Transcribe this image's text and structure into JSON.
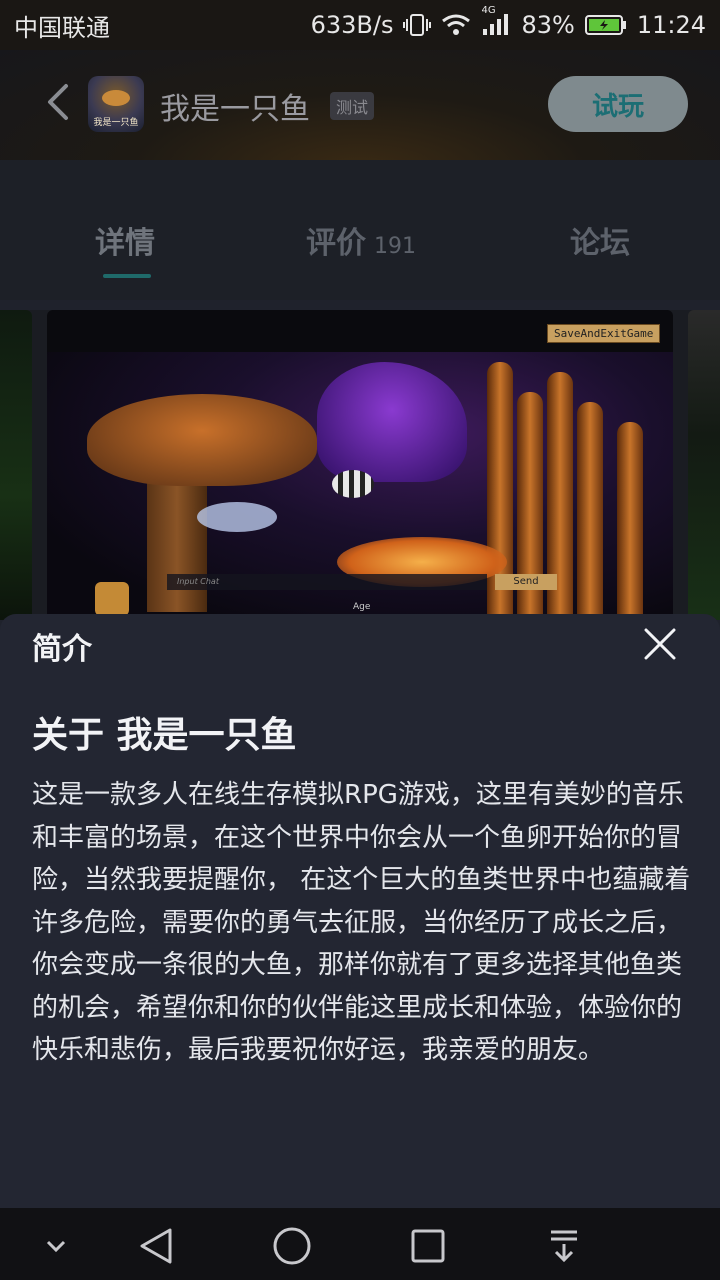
{
  "status_bar": {
    "carrier": "中国联通",
    "speed": "633B/s",
    "network": "4G",
    "battery": "83%",
    "time": "11:24"
  },
  "header": {
    "app_name": "我是一只鱼",
    "badge": "测试",
    "icon_text": "我是一只鱼",
    "try_button": "试玩"
  },
  "tabs": [
    {
      "label": "详情",
      "active": true
    },
    {
      "label": "评价",
      "count": "191"
    },
    {
      "label": "论坛"
    }
  ],
  "screenshot": {
    "save_button": "SaveAndExitGame",
    "chat_placeholder": "Input Chat",
    "send_button": "Send",
    "age_label": "Age"
  },
  "intro": {
    "title": "简介",
    "heading": "关于 我是一只鱼",
    "description": "这是一款多人在线生存模拟RPG游戏，这里有美妙的音乐和丰富的场景，在这个世界中你会从一个鱼卵开始你的冒险，当然我要提醒你， 在这个巨大的鱼类世界中也蕴藏着许多危险，需要你的勇气去征服，当你经历了成长之后，你会变成一条很的大鱼，那样你就有了更多选择其他鱼类的机会，希望你和你的伙伴能这里成长和体验，体验你的快乐和悲伤，最后我要祝你好运，我亲爱的朋友。"
  },
  "nav_bar": {
    "icons": [
      "chevron-down-icon",
      "back-triangle-icon",
      "home-circle-icon",
      "recents-square-icon",
      "notification-pull-icon"
    ]
  },
  "colors": {
    "sheet_bg": "#232632",
    "accent_teal": "#1f6a6a",
    "try_button_bg": "#7f8a8e"
  }
}
